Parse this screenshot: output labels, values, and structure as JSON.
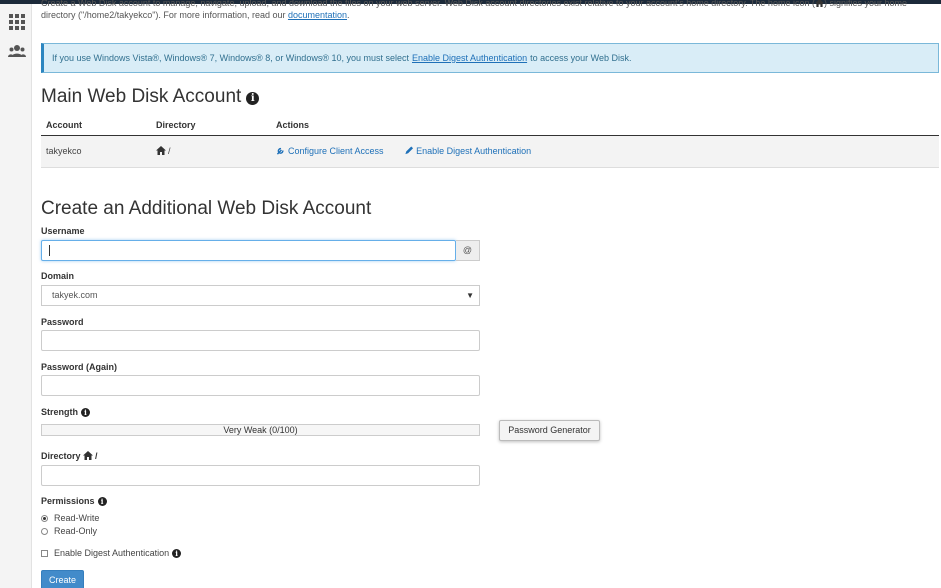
{
  "intro": {
    "line1": "Create a Web Disk account to manage, navigate, upload, and download the files on your web server. Web Disk account directories exist relative to your account's home directory. The home icon (",
    "line1b": ") signifies your home",
    "line2": "directory (\"/home2/takyekco\"). For more information, read our ",
    "doc_link": "documentation",
    "line2_end": "."
  },
  "alert": {
    "text_before": "If you use Windows Vista®, Windows® 7, Windows® 8, or Windows® 10, you must select",
    "link": "Enable Digest Authentication",
    "text_after": "to access your Web Disk."
  },
  "main_account": {
    "title": "Main Web Disk Account",
    "columns": [
      "Account",
      "Directory",
      "Actions"
    ],
    "row": {
      "account": "takyekco",
      "directory": "/",
      "action1": "Configure Client Access",
      "action2": "Enable Digest Authentication"
    }
  },
  "create": {
    "title": "Create an Additional Web Disk Account",
    "username_label": "Username",
    "username_value": "",
    "at_symbol": "@",
    "domain_label": "Domain",
    "domain_value": "takyek.com",
    "password_label": "Password",
    "password_again_label": "Password (Again)",
    "strength_label": "Strength",
    "strength_text": "Very Weak (0/100)",
    "strength_value": 0,
    "password_generator": "Password Generator",
    "directory_label": "Directory",
    "directory_suffix": "/",
    "permissions_label": "Permissions",
    "perm_rw": "Read-Write",
    "perm_ro": "Read-Only",
    "perm_selected": "Read-Write",
    "digest_label": "Enable Digest Authentication",
    "digest_checked": false,
    "create_button": "Create"
  },
  "colors": {
    "accent": "#1e70b8",
    "alert_bg": "#d9edf7",
    "button_primary": "#428bca"
  },
  "sidebar": {
    "icons": [
      "apps-grid-icon",
      "users-icon"
    ]
  }
}
